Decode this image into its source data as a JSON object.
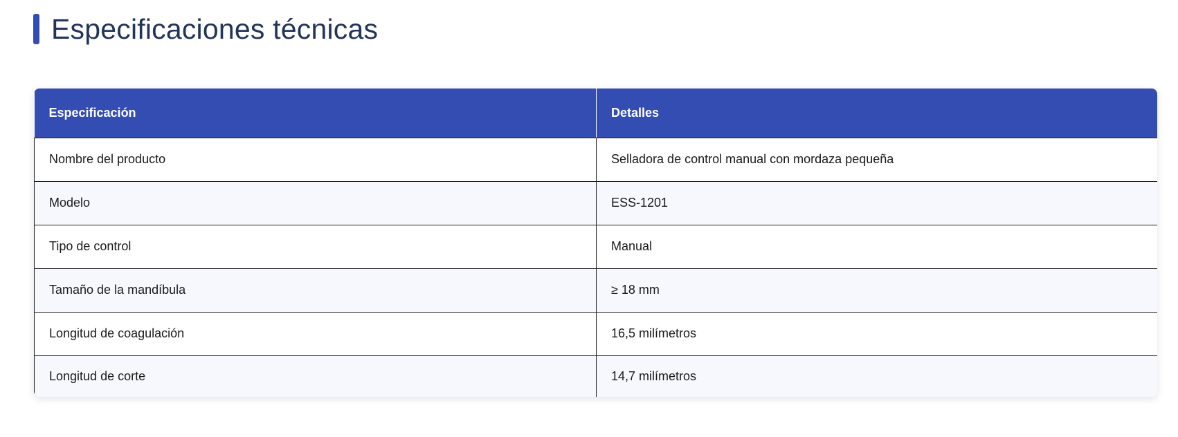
{
  "section": {
    "title": "Especificaciones técnicas"
  },
  "spec_table": {
    "headers": [
      "Especificación",
      "Detalles"
    ],
    "rows": [
      [
        "Nombre del producto",
        "Selladora de control manual con mordaza pequeña"
      ],
      [
        "Modelo",
        "ESS-1201"
      ],
      [
        "Tipo de control",
        "Manual"
      ],
      [
        "Tamaño de la mandíbula",
        "≥ 18 mm"
      ],
      [
        "Longitud de coagulación",
        "16,5 milímetros"
      ],
      [
        "Longitud de corte",
        "14,7 milímetros"
      ]
    ]
  },
  "colors": {
    "accent": "#344db2",
    "title_text": "#223458",
    "row_alt": "#f7f8fd"
  }
}
